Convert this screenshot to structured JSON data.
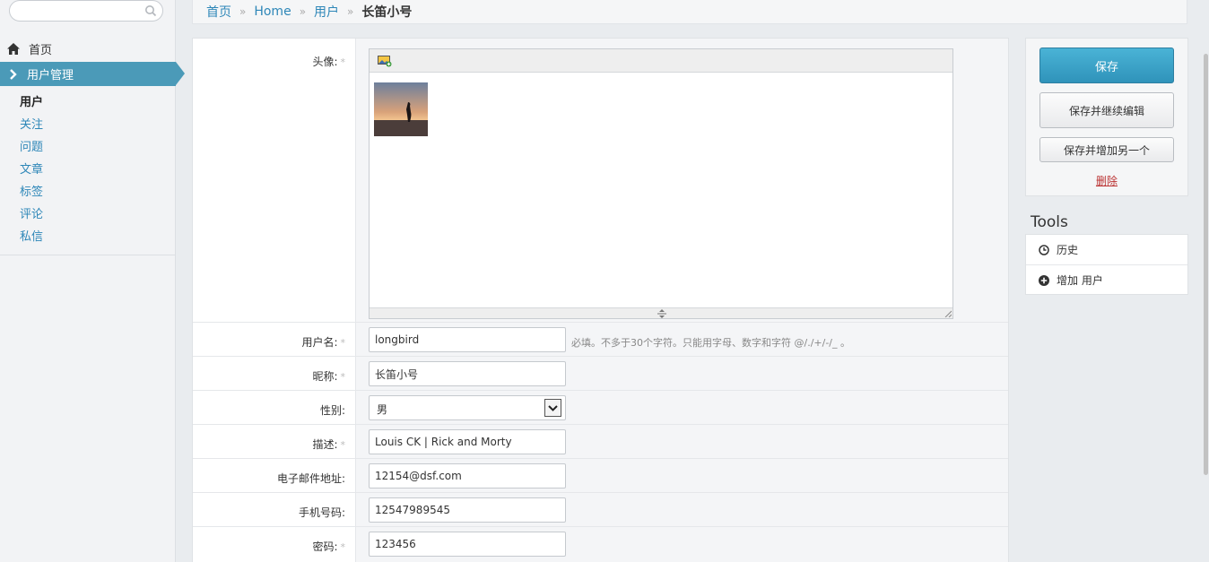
{
  "sidebar": {
    "search_placeholder": "",
    "home_label": "首页",
    "active_section": "用户管理",
    "items": [
      {
        "label": "用户",
        "current": true
      },
      {
        "label": "关注"
      },
      {
        "label": "问题"
      },
      {
        "label": "文章"
      },
      {
        "label": "标签"
      },
      {
        "label": "评论"
      },
      {
        "label": "私信"
      }
    ]
  },
  "breadcrumb": {
    "items": [
      "首页",
      "Home",
      "用户"
    ],
    "separator": "»",
    "current": "长笛小号"
  },
  "form": {
    "avatar_label": "头像:",
    "required_mark": "*",
    "username_label": "用户名:",
    "username_value": "longbird",
    "username_help": "必填。不多于30个字符。只能用字母、数字和字符 @/./+/-/_ 。",
    "nickname_label": "昵称:",
    "nickname_value": "长笛小号",
    "gender_label": "性别:",
    "gender_value": "男",
    "description_label": "描述:",
    "description_value": "Louis CK | Rick and Morty",
    "email_label": "电子邮件地址:",
    "email_value": "12154@dsf.com",
    "phone_label": "手机号码:",
    "phone_value": "12547989545",
    "password_label": "密码:",
    "password_value": "123456"
  },
  "actions": {
    "save": "保存",
    "save_continue": "保存并继续编辑",
    "save_add_another": "保存并增加另一个",
    "delete": "删除"
  },
  "tools": {
    "title": "Tools",
    "history": "历史",
    "add_user": "增加 用户"
  },
  "colors": {
    "accent": "#4b9ab8",
    "link": "#2e87b8",
    "primary_button": "#3aa3c9",
    "delete": "#bb3333"
  }
}
